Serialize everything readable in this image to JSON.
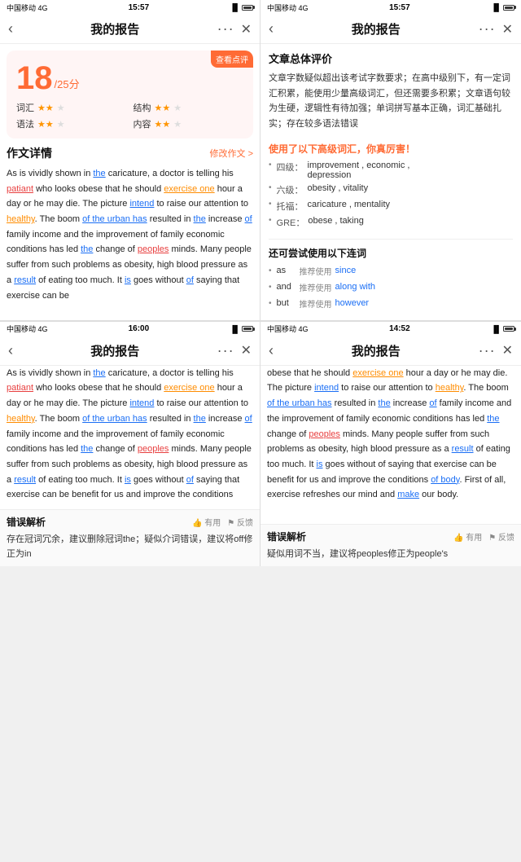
{
  "topLeft": {
    "statusBar": {
      "carrier": "中国移动 4G",
      "time": "15:57",
      "rightCarrier": ""
    },
    "navTitle": "我的报告",
    "viewReviewBtn": "查看点评",
    "score": "18",
    "scoreTotal": "/25分",
    "metrics": [
      {
        "label": "词汇",
        "stars": 2,
        "total": 3
      },
      {
        "label": "结构",
        "stars": 2,
        "total": 3
      },
      {
        "label": "语法",
        "stars": 2,
        "total": 3
      },
      {
        "label": "内容",
        "stars": 2,
        "total": 3
      }
    ],
    "essayTitle": "作文详情",
    "editBtn": "修改作文 >",
    "essayText": "As is vividly shown in the caricature, a doctor is telling his patiant who looks obese that he should exercise one hour a day or he may die. The picture intend to raise our attention to healthy. The boom of the urban has resulted in the increase of family income and the improvement of family economic conditions has led the change of peoples minds. Many people suffer from such problems as obesity, high blood pressure as a result of eating too much. It is goes without of saying that exercise can be"
  },
  "topRight": {
    "statusBar": {
      "carrier": "中国移动 4G",
      "time": "15:57"
    },
    "navTitle": "我的报告",
    "overallTitle": "文章总体评价",
    "overallText": "文章字数疑似超出该考试字数要求；在高中级别下，有一定词汇积累，能使用少量高级词汇，但还需要多积累；文章语句较为生硬，逻辑性有待加强；单词拼写基本正确，词汇基础扎实；存在较多语法错误",
    "vocabTitle": "使用了以下高级词汇，你真厉害！",
    "vocabItems": [
      {
        "level": "四级：",
        "words": "improvement , economic , depression"
      },
      {
        "level": "六级：",
        "words": "obesity , vitality"
      },
      {
        "level": "托福：",
        "words": "caricature , mentality"
      },
      {
        "level": "GRE：",
        "words": "obese , taking"
      }
    ],
    "connectorTitle": "还可尝试使用以下连词",
    "connectors": [
      {
        "word": "as",
        "suggest": "推荐使用",
        "value": "since"
      },
      {
        "word": "and",
        "suggest": "推荐使用",
        "value": "along with"
      },
      {
        "word": "but",
        "suggest": "推荐使用",
        "value": "however"
      }
    ]
  },
  "bottomLeft": {
    "statusBar": {
      "carrier": "中国移动 4G",
      "time": "16:00"
    },
    "navTitle": "我的报告",
    "essayText": "As is vividly shown in the caricature, a doctor is telling his patiant who looks obese that he should exercise one hour a day or he may die. The picture intend to raise our attention to healthy. The boom of the urban has resulted in the increase of family income and the improvement of family economic conditions has led the change of peoples minds. Many people suffer from such problems as obesity, high blood pressure as a result of eating too much. It is goes without of saying that exercise can be benefit for us and improve the conditions",
    "errorTitle": "错误解析",
    "errorActions": [
      "有用",
      "反馈"
    ],
    "errorText": "存在冠词冗余，建议删除冠词the；疑似介词错误，建议将off修正为in"
  },
  "bottomRight": {
    "statusBar": {
      "carrier": "中国移动 4G",
      "time": "14:52"
    },
    "navTitle": "我的报告",
    "essayText": "obese that he should exercise one hour a day or he may die. The picture intend to raise our attention to healthy. The boom of the urban has resulted in the increase of family income and the improvement of family economic conditions has led the change of peoples minds. Many people suffer from such problems as obesity, high blood pressure as a result of eating too much. It is goes without of saying that exercise can be benefit for us and improve the conditions of body. First of all, exercise refreshes our mind and make our body.",
    "errorTitle": "错误解析",
    "errorActions": [
      "有用",
      "反馈"
    ],
    "errorText": "疑似用词不当，建议将peoples修正为people's"
  }
}
